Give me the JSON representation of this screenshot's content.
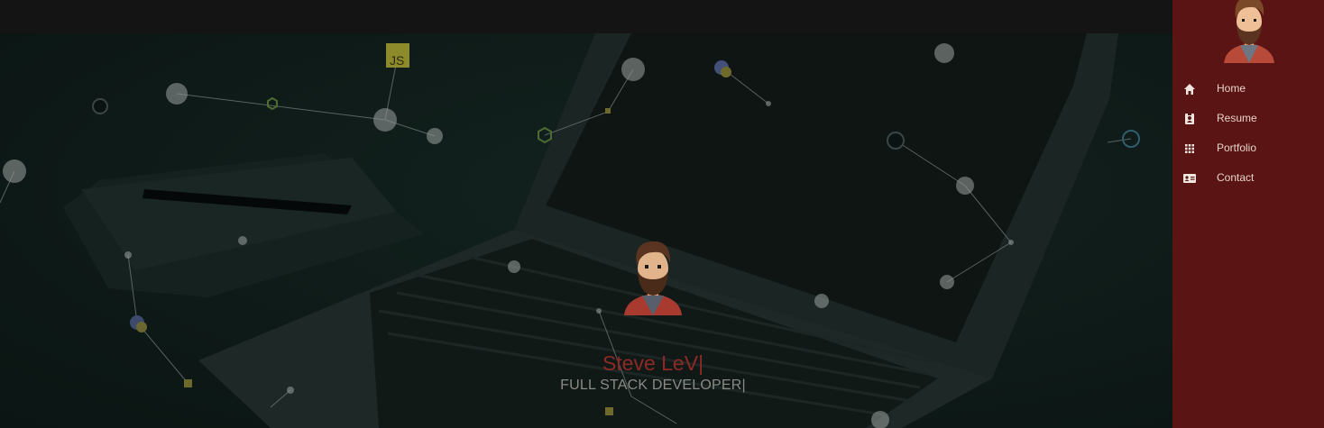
{
  "profile": {
    "name": "Steve LeV|",
    "title": "FULL STACK DEVELOPER|"
  },
  "sidebar": {
    "items": [
      {
        "label": "Home",
        "icon": "home-icon"
      },
      {
        "label": "Resume",
        "icon": "badge-icon"
      },
      {
        "label": "Portfolio",
        "icon": "grid-icon"
      },
      {
        "label": "Contact",
        "icon": "contact-card-icon"
      }
    ]
  },
  "background": {
    "overlay_badge_js": "JS"
  },
  "colors": {
    "sidebar": "#5a1414",
    "name": "#8c2a26",
    "title": "#8a8a86",
    "topbar": "#141414"
  }
}
